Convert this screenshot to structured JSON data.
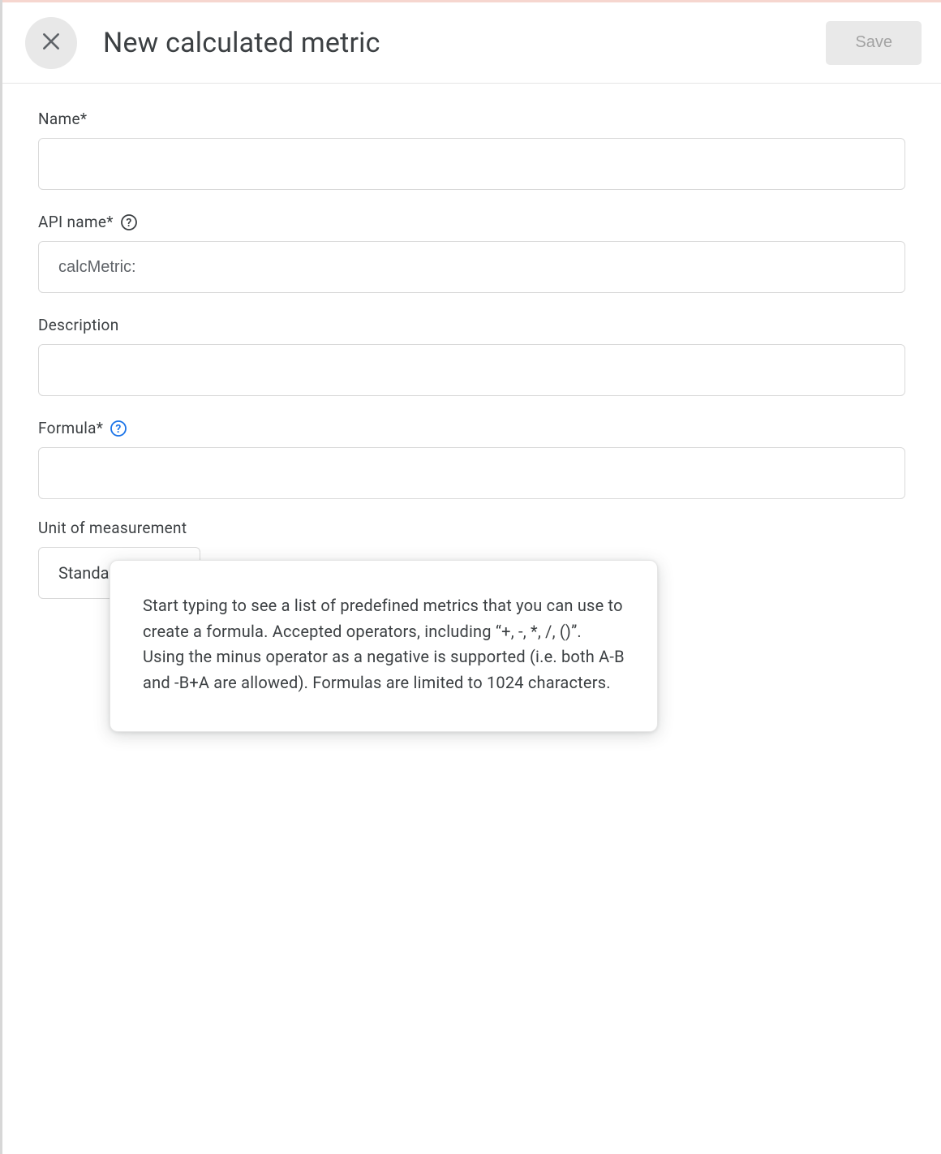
{
  "header": {
    "title": "New calculated metric",
    "save_label": "Save"
  },
  "fields": {
    "name": {
      "label": "Name*",
      "value": ""
    },
    "api_name": {
      "label": "API name*",
      "value": "calcMetric:"
    },
    "description": {
      "label": "Description",
      "value": ""
    },
    "formula": {
      "label": "Formula*",
      "value": ""
    },
    "unit": {
      "label": "Unit of measurement",
      "value": "Standard"
    }
  },
  "tooltip": {
    "text": "Start typing to see a list of predefined metrics that you can use to create a formula. Accepted operators, including “+, -, *, /, ()”. Using the minus operator as a negative is supported (i.e. both A-B and -B+A are allowed). Formulas are limited to 1024 characters."
  }
}
